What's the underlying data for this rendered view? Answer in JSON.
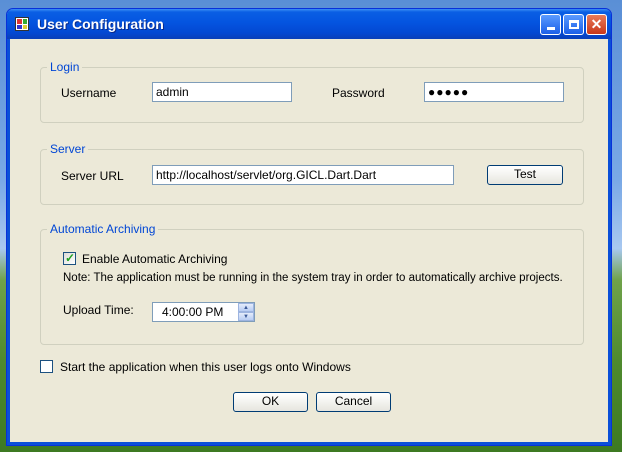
{
  "window": {
    "title": "User Configuration"
  },
  "login": {
    "legend": "Login",
    "username_label": "Username",
    "username_value": "admin",
    "password_label": "Password",
    "password_value": "●●●●●"
  },
  "server": {
    "legend": "Server",
    "url_label": "Server URL",
    "url_value": "http://localhost/servlet/org.GICL.Dart.Dart",
    "test_label": "Test"
  },
  "archiving": {
    "legend": "Automatic Archiving",
    "enable_label": "Enable Automatic Archiving",
    "enable_checked": true,
    "note": "Note: The application must be running in the system tray in order to automatically archive projects.",
    "upload_time_label": "Upload Time:",
    "upload_time_value": "4:00:00 PM"
  },
  "startup": {
    "label": "Start the application when this user logs onto Windows",
    "checked": false
  },
  "buttons": {
    "ok": "OK",
    "cancel": "Cancel"
  }
}
